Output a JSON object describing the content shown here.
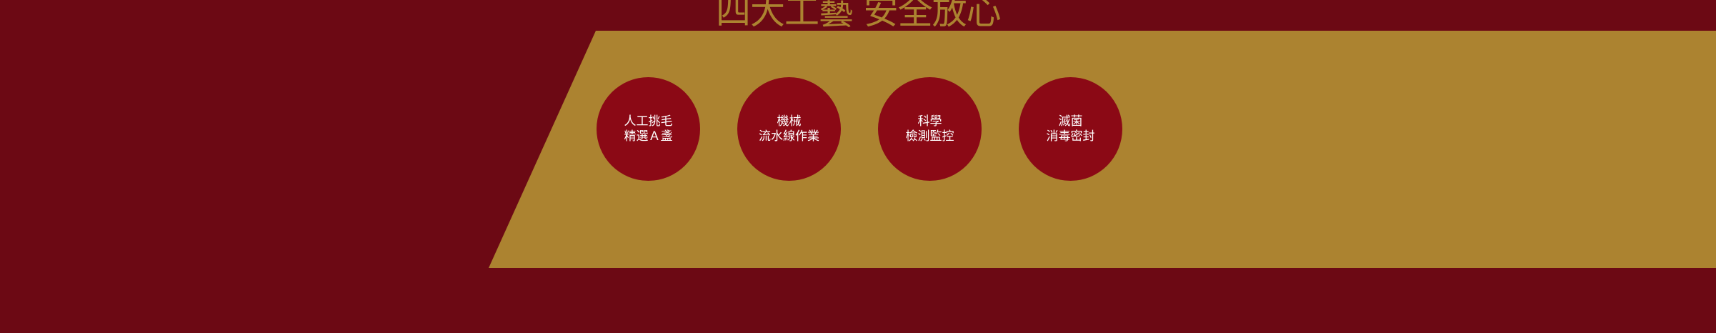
{
  "headline": "四大工藝 安全放心",
  "colors": {
    "background": "#6c0914",
    "band": "#ac8330",
    "circle": "#8b0915",
    "headline": "#ac8330",
    "circle_text": "#ffffff"
  },
  "crafts": [
    {
      "line1": "人工挑毛",
      "line2": "精選Ａ盞"
    },
    {
      "line1": "機械",
      "line2": "流水線作業"
    },
    {
      "line1": "科學",
      "line2": "檢測監控"
    },
    {
      "line1": "滅菌",
      "line2": "消毒密封"
    }
  ]
}
